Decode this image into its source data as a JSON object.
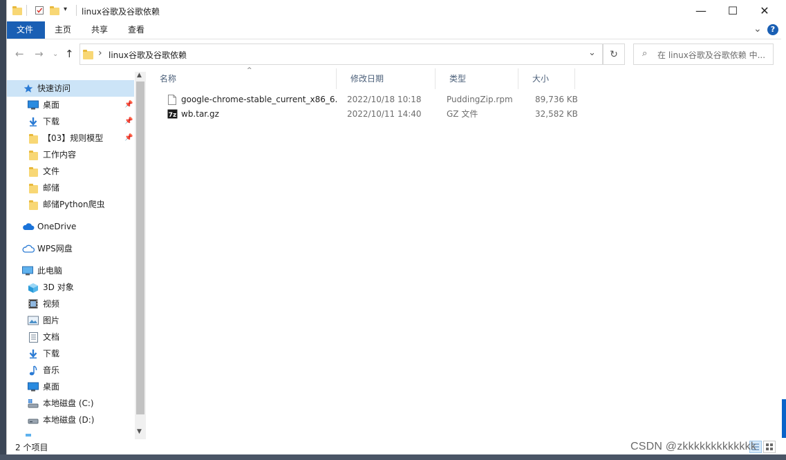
{
  "window": {
    "title": "linux谷歌及谷歌依赖",
    "controls": {
      "minimize": "—",
      "maximize": "☐",
      "close": "✕"
    }
  },
  "ribbon": {
    "tabs": [
      "文件",
      "主页",
      "共享",
      "查看"
    ],
    "expand_glyph": "⌄",
    "help_glyph": "?"
  },
  "address": {
    "path_segment": "linux谷歌及谷歌依赖",
    "separator": "›",
    "search_placeholder": "在 linux谷歌及谷歌依赖 中..."
  },
  "nav": {
    "quick_access": "快速访问",
    "quick_items": [
      {
        "label": "桌面",
        "pinned": true
      },
      {
        "label": "下载",
        "pinned": true
      },
      {
        "label": "【03】规则模型",
        "pinned": true
      },
      {
        "label": "工作内容",
        "pinned": false
      },
      {
        "label": "文件",
        "pinned": false
      },
      {
        "label": "邮储",
        "pinned": false
      },
      {
        "label": "邮储Python爬虫",
        "pinned": false
      }
    ],
    "onedrive": "OneDrive",
    "wps": "WPS网盘",
    "this_pc": "此电脑",
    "pc_items": [
      "3D 对象",
      "视频",
      "图片",
      "文档",
      "下载",
      "音乐",
      "桌面",
      "本地磁盘 (C:)",
      "本地磁盘 (D:)"
    ]
  },
  "columns": {
    "name": "名称",
    "date": "修改日期",
    "type": "类型",
    "size": "大小"
  },
  "files": [
    {
      "name": "google-chrome-stable_current_x86_6...",
      "date": "2022/10/18 10:18",
      "type": "PuddingZip.rpm",
      "size": "89,736 KB",
      "icon": "blank-file-icon"
    },
    {
      "name": "wb.tar.gz",
      "date": "2022/10/11 14:40",
      "type": "GZ 文件",
      "size": "32,582 KB",
      "icon": "7zip-archive-icon"
    }
  ],
  "status": {
    "item_count": "2 个项目"
  },
  "watermark": "CSDN @zkkkkkkkkkkkkk",
  "colors": {
    "accent": "#1a5fb4",
    "selection": "#cce4f7",
    "folder": "#f8d775"
  }
}
